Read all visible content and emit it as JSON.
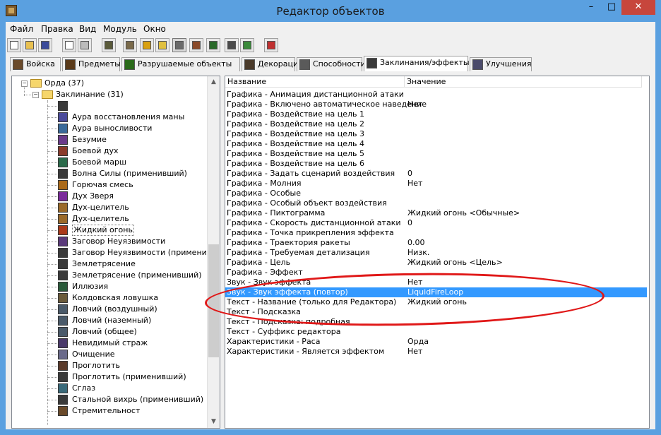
{
  "window": {
    "title": "Редактор объектов"
  },
  "menu": [
    "Файл",
    "Правка",
    "Вид",
    "Модуль",
    "Окно"
  ],
  "toolbar_icons": [
    "new-icon",
    "open-icon",
    "save-icon",
    "copy-icon",
    "paste-icon",
    "units-icon",
    "terrain-icon",
    "sound-icon",
    "volume-icon",
    "editor-icon",
    "models-icon",
    "trigger-icon",
    "book-icon",
    "import-icon",
    "object-icon"
  ],
  "tabs": [
    {
      "label": "Войска",
      "icon": "units-tab-icon",
      "color": "#6a4a2a"
    },
    {
      "label": "Предметы",
      "icon": "items-tab-icon",
      "color": "#5a3a1a"
    },
    {
      "label": "Разрушаемые объекты",
      "icon": "destructibles-tab-icon",
      "color": "#2a6a1a"
    },
    {
      "label": "Декорации",
      "icon": "doodads-tab-icon",
      "color": "#4a3a2a"
    },
    {
      "label": "Способности",
      "icon": "abilities-tab-icon",
      "color": "#5a5a5a"
    },
    {
      "label": "Заклинания/эффекты",
      "icon": "buffs-tab-icon",
      "color": "#3a3a3a"
    },
    {
      "label": "Улучшения",
      "icon": "upgrades-tab-icon",
      "color": "#4a4a6a"
    }
  ],
  "tree": {
    "root": "Орда (37)",
    "group": "Заклинание (31)",
    "items": [
      {
        "label": "",
        "color": "#3a3a3a"
      },
      {
        "label": "Аура восстановления маны",
        "color": "#4a4a9a"
      },
      {
        "label": "Аура выносливости",
        "color": "#3a6a9a"
      },
      {
        "label": "Безумие",
        "color": "#6a3a8a"
      },
      {
        "label": "Боевой дух",
        "color": "#8a3a2a"
      },
      {
        "label": "Боевой марш",
        "color": "#2a6a4a"
      },
      {
        "label": "Волна Силы (применивший)",
        "color": "#3a3a3a"
      },
      {
        "label": "Горючая смесь",
        "color": "#aa6a1a"
      },
      {
        "label": "Дух Зверя",
        "color": "#7a2a9a"
      },
      {
        "label": "Дух-целитель",
        "color": "#9a6a2a"
      },
      {
        "label": "Дух-целитель",
        "color": "#9a6a2a"
      },
      {
        "label": "Жидкий огонь",
        "color": "#aa3a1a"
      },
      {
        "label": "Заговор Неуязвимости",
        "color": "#5a3a7a"
      },
      {
        "label": "Заговор Неуязвимости (применивший)",
        "color": "#3a3a3a"
      },
      {
        "label": "Землетрясение",
        "color": "#3a3a3a"
      },
      {
        "label": "Землетрясение (применивший)",
        "color": "#3a3a3a"
      },
      {
        "label": "Иллюзия",
        "color": "#2a5a3a"
      },
      {
        "label": "Колдовская ловушка",
        "color": "#6a5a3a"
      },
      {
        "label": "Ловчий (воздушный)",
        "color": "#4a5a6a"
      },
      {
        "label": "Ловчий (наземный)",
        "color": "#4a5a6a"
      },
      {
        "label": "Ловчий (общее)",
        "color": "#4a5a6a"
      },
      {
        "label": "Невидимый страж",
        "color": "#4a3a6a"
      },
      {
        "label": "Очищение",
        "color": "#6a6a8a"
      },
      {
        "label": "Проглотить",
        "color": "#5a3a2a"
      },
      {
        "label": "Проглотить (применивший)",
        "color": "#3a3a3a"
      },
      {
        "label": "Сглаз",
        "color": "#3a6a7a"
      },
      {
        "label": "Стальной вихрь (применивший)",
        "color": "#3a3a3a"
      },
      {
        "label": "Стремительност",
        "color": "#6a4a2a"
      }
    ]
  },
  "table": {
    "col_name": "Название",
    "col_value": "Значение",
    "rows": [
      {
        "name": "Графика - Анимация дистанционной атаки",
        "value": ""
      },
      {
        "name": "Графика - Включено автоматическое наведение",
        "value": "Нет"
      },
      {
        "name": "Графика - Воздействие на цель 1",
        "value": ""
      },
      {
        "name": "Графика - Воздействие на цель 2",
        "value": ""
      },
      {
        "name": "Графика - Воздействие на цель 3",
        "value": ""
      },
      {
        "name": "Графика - Воздействие на цель 4",
        "value": ""
      },
      {
        "name": "Графика - Воздействие на цель 5",
        "value": ""
      },
      {
        "name": "Графика - Воздействие на цель 6",
        "value": ""
      },
      {
        "name": "Графика - Задать сценарий воздействия",
        "value": "0"
      },
      {
        "name": "Графика - Молния",
        "value": "Нет"
      },
      {
        "name": "Графика - Особые",
        "value": ""
      },
      {
        "name": "Графика - Особый объект воздействия",
        "value": ""
      },
      {
        "name": "Графика - Пиктограмма",
        "value": "Жидкий огонь <Обычные>"
      },
      {
        "name": "Графика - Скорость дистанционной атаки",
        "value": "0"
      },
      {
        "name": "Графика - Точка прикрепления эффекта",
        "value": ""
      },
      {
        "name": "Графика - Траектория ракеты",
        "value": "0.00"
      },
      {
        "name": "Графика - Требуемая детализация",
        "value": "Низк."
      },
      {
        "name": "Графика - Цель",
        "value": "Жидкий огонь <Цель>"
      },
      {
        "name": "Графика - Эффект",
        "value": ""
      },
      {
        "name": "Звук - Звук эффекта",
        "value": "Нет"
      },
      {
        "name": "Звук - Звук эффекта (повтор)",
        "value": "LiquidFireLoop"
      },
      {
        "name": "Текст - Название (только для Редактора)",
        "value": "Жидкий огонь"
      },
      {
        "name": "Текст - Подсказка",
        "value": ""
      },
      {
        "name": "Текст - Подсказка: подробная",
        "value": ""
      },
      {
        "name": "Текст - Суффикс редактора",
        "value": ""
      },
      {
        "name": "Характеристики - Раса",
        "value": "Орда"
      },
      {
        "name": "Характеристики - Является эффектом",
        "value": "Нет"
      }
    ],
    "selected_row": 20
  },
  "colors": {
    "selection": "#3399ff",
    "annotation": "#e01818",
    "titlebar": "#5aa0e0"
  }
}
